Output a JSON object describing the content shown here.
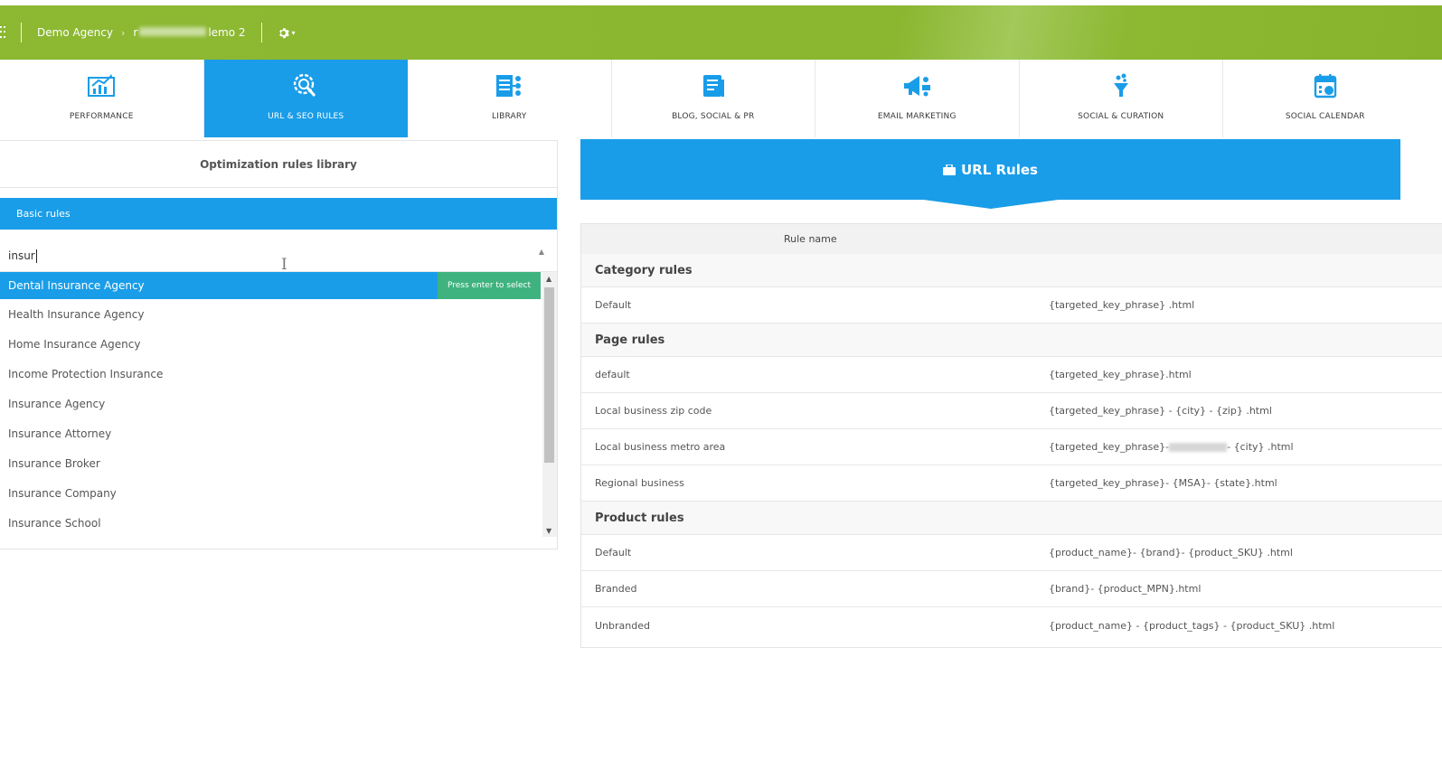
{
  "topbar": {
    "agency": "Demo Agency",
    "project_prefix": "r",
    "project_suffix": "lemo 2",
    "settings_caret": "▾"
  },
  "nav": [
    {
      "label": "PERFORMANCE",
      "icon": "chart-icon",
      "active": false
    },
    {
      "label": "URL & SEO RULES",
      "icon": "seo-gear-icon",
      "active": true
    },
    {
      "label": "LIBRARY",
      "icon": "library-icon",
      "active": false
    },
    {
      "label": "BLOG, SOCIAL & PR",
      "icon": "document-icon",
      "active": false
    },
    {
      "label": "EMAIL MARKETING",
      "icon": "megaphone-icon",
      "active": false
    },
    {
      "label": "SOCIAL & CURATION",
      "icon": "funnel-icon",
      "active": false
    },
    {
      "label": "SOCIAL CALENDAR",
      "icon": "calendar-icon",
      "active": false
    }
  ],
  "library": {
    "title": "Optimization rules library",
    "group_label": "Basic rules",
    "search_value": "insur",
    "hint": "Press enter to select",
    "options": [
      "Dental Insurance Agency",
      "Health Insurance Agency",
      "Home Insurance Agency",
      "Income Protection Insurance",
      "Insurance Agency",
      "Insurance Attorney",
      "Insurance Broker",
      "Insurance Company",
      "Insurance School"
    ]
  },
  "url_rules": {
    "title": "URL Rules",
    "column_header": "Rule name",
    "groups": {
      "category": {
        "label": "Category rules",
        "rows": [
          {
            "name": "Default",
            "pattern": "{targeted_key_phrase} .html"
          }
        ]
      },
      "page": {
        "label": "Page rules",
        "rows": [
          {
            "name": "default",
            "pattern": "{targeted_key_phrase}.html"
          },
          {
            "name": "Local business zip code",
            "pattern": "{targeted_key_phrase} - {city} - {zip} .html"
          },
          {
            "name": "Local business metro area",
            "pattern_start": "{targeted_key_phrase}-",
            "pattern_end": "- {city} .html"
          },
          {
            "name": "Regional business",
            "pattern": "{targeted_key_phrase}- {MSA}- {state}.html"
          }
        ]
      },
      "product": {
        "label": "Product rules",
        "rows": [
          {
            "name": "Default",
            "pattern": "{product_name}- {brand}- {product_SKU} .html"
          },
          {
            "name": "Branded",
            "pattern": "{brand}- {product_MPN}.html"
          },
          {
            "name": "Unbranded",
            "pattern": "{product_name} - {product_tags} - {product_SKU} .html"
          }
        ]
      }
    }
  },
  "colors": {
    "green": "#8cb832",
    "blue": "#1a9de8",
    "hint_green": "#3fb37f"
  }
}
